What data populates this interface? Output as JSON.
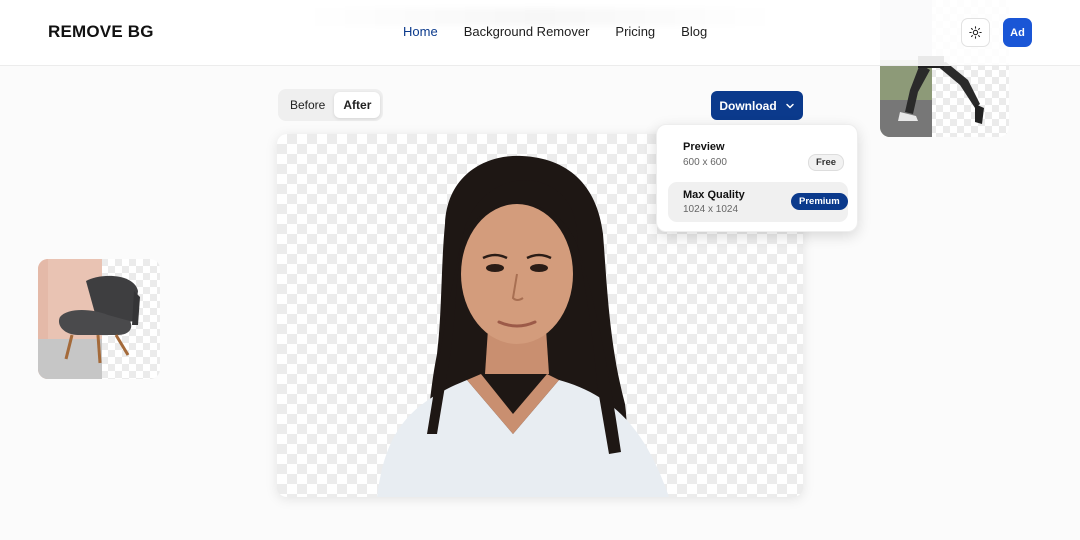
{
  "header": {
    "logo": "REMOVE BG",
    "nav": [
      {
        "label": "Home",
        "active": true
      },
      {
        "label": "Background Remover",
        "active": false
      },
      {
        "label": "Pricing",
        "active": false
      },
      {
        "label": "Blog",
        "active": false
      }
    ],
    "theme_icon": "sun-icon",
    "avatar_initials": "Ad"
  },
  "toggle": {
    "before_label": "Before",
    "after_label": "After",
    "selected": "After"
  },
  "download": {
    "button_label": "Download",
    "options": [
      {
        "title": "Preview",
        "size": "600 x 600",
        "badge": "Free"
      },
      {
        "title": "Max Quality",
        "size": "1024 x 1024",
        "badge": "Premium"
      }
    ]
  },
  "colors": {
    "accent": "#0b3a8c",
    "avatar": "#1a56d6"
  }
}
